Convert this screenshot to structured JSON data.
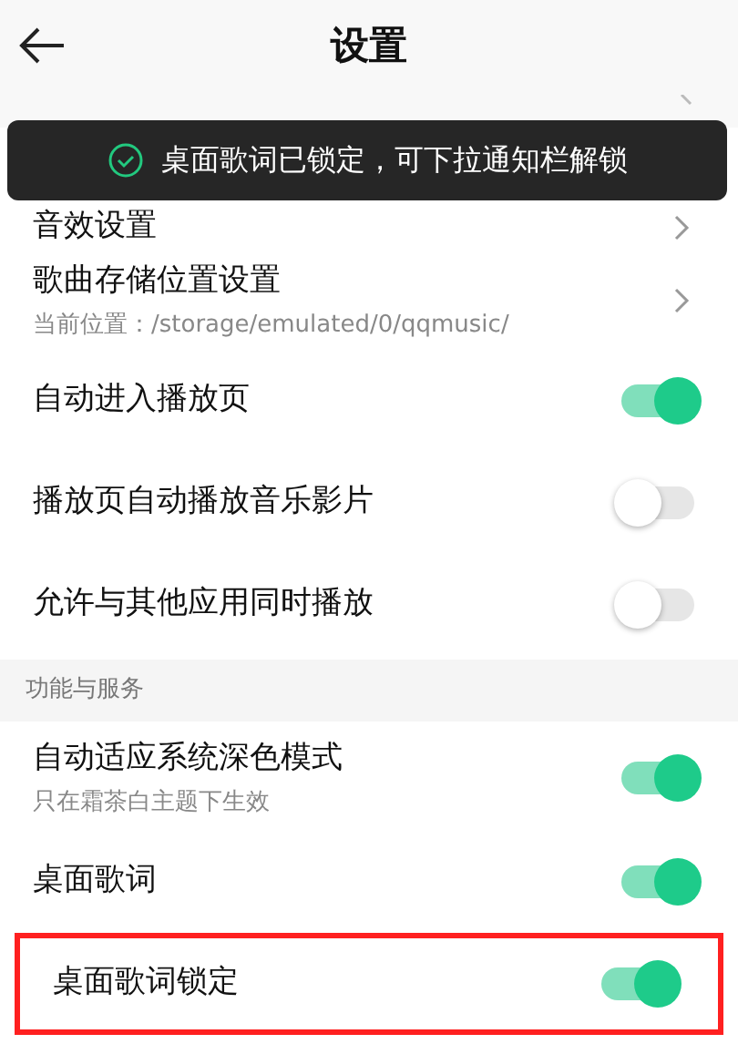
{
  "header": {
    "title": "设置"
  },
  "toast": {
    "text": "桌面歌词已锁定，可下拉通知栏解锁"
  },
  "rows": [
    {
      "kind": "link",
      "label": "音效设置"
    },
    {
      "kind": "link",
      "label": "歌曲存储位置设置",
      "subtitle": "当前位置：/storage/emulated/0/qqmusic/"
    },
    {
      "kind": "toggle",
      "label": "自动进入播放页",
      "on": true
    },
    {
      "kind": "toggle",
      "label": "播放页自动播放音乐影片",
      "on": false
    },
    {
      "kind": "toggle",
      "label": "允许与其他应用同时播放",
      "on": false
    },
    {
      "kind": "section",
      "label": "功能与服务"
    },
    {
      "kind": "toggle",
      "label": "自动适应系统深色模式",
      "subtitle": "只在霜茶白主题下生效",
      "on": true
    },
    {
      "kind": "toggle",
      "label": "桌面歌词",
      "on": true
    },
    {
      "kind": "toggle",
      "label": "桌面歌词锁定",
      "on": true,
      "highlighted": true
    }
  ]
}
